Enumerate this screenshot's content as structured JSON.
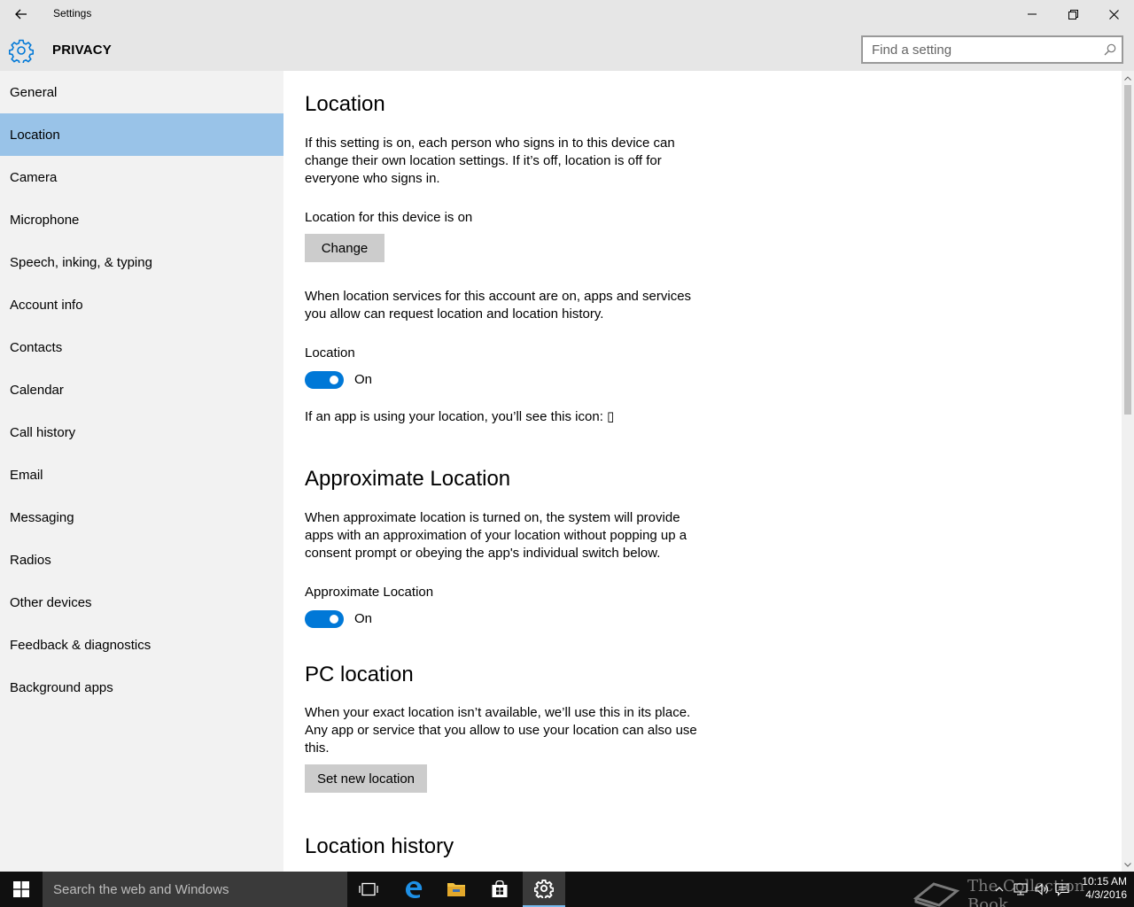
{
  "window": {
    "title": "Settings",
    "back_label": "back"
  },
  "header": {
    "section_title": "PRIVACY",
    "search_placeholder": "Find a setting"
  },
  "sidebar": {
    "items": [
      {
        "label": "General"
      },
      {
        "label": "Location",
        "selected": true
      },
      {
        "label": "Camera"
      },
      {
        "label": "Microphone"
      },
      {
        "label": "Speech, inking, & typing"
      },
      {
        "label": "Account info"
      },
      {
        "label": "Contacts"
      },
      {
        "label": "Calendar"
      },
      {
        "label": "Call history"
      },
      {
        "label": "Email"
      },
      {
        "label": "Messaging"
      },
      {
        "label": "Radios"
      },
      {
        "label": "Other devices"
      },
      {
        "label": "Feedback & diagnostics"
      },
      {
        "label": "Background apps"
      }
    ]
  },
  "main": {
    "location": {
      "title": "Location",
      "description": "If this setting is on, each person who signs in to this device can change their own location settings. If it’s off, location is off for everyone who signs in.",
      "device_status": "Location for this device is on",
      "change_button": "Change",
      "account_description": "When location services for this account are on, apps and services you allow can request location and location history.",
      "toggle_label": "Location",
      "toggle_state": "On",
      "icon_note": "If an app is using your location, you’ll see this icon: ▯"
    },
    "approximate": {
      "title": "Approximate Location",
      "description": "When approximate location is turned on, the system will provide apps with an approximation of your location without popping up a consent prompt or obeying the app's individual switch below.",
      "toggle_label": "Approximate Location",
      "toggle_state": "On"
    },
    "pc_location": {
      "title": "PC location",
      "description": "When your exact location isn’t available, we’ll use this in its place. Any app or service that you allow to use your location can also use this.",
      "button": "Set new location"
    },
    "history": {
      "title": "Location history"
    }
  },
  "taskbar": {
    "search_text": "Search the web and Windows",
    "clock_time": "10:15 AM",
    "clock_date": "4/3/2016",
    "watermark": "The Collection Book"
  },
  "colors": {
    "accent": "#0078d7",
    "selection": "#99c3e8",
    "sidebar_bg": "#f2f2f2",
    "chrome_bg": "#e6e6e6",
    "taskbar_bg": "#101010"
  }
}
